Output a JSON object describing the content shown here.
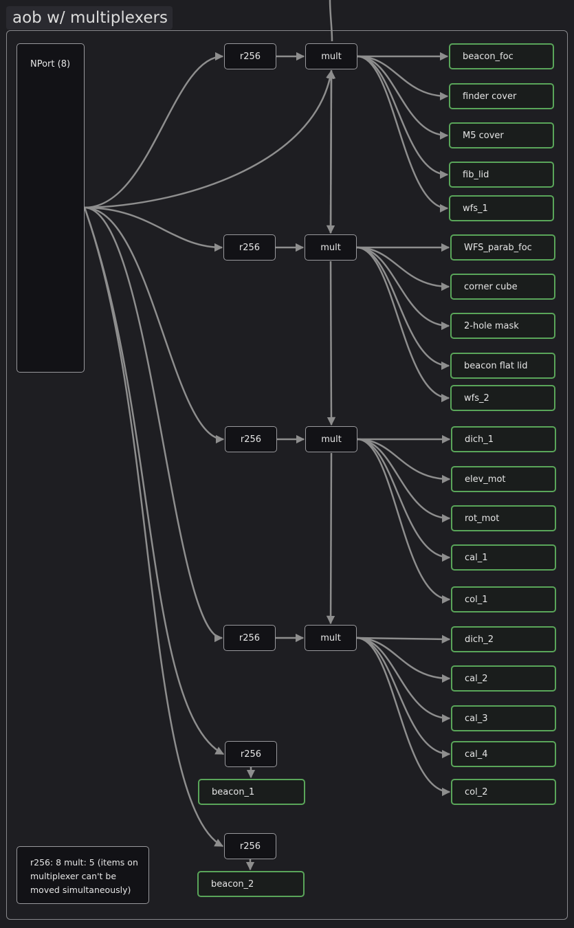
{
  "title": "aob w/ multiplexers",
  "source": "NPort (8)",
  "r256_label": "r256",
  "mult_label": "mult",
  "groups": [
    {
      "targets": [
        "beacon_foc",
        "finder cover",
        "M5 cover",
        "fib_lid",
        "wfs_1"
      ]
    },
    {
      "targets": [
        "WFS_parab_foc",
        "corner cube",
        "2-hole mask",
        "beacon flat lid",
        "wfs_2"
      ]
    },
    {
      "targets": [
        "dich_1",
        "elev_mot",
        "rot_mot",
        "cal_1",
        "col_1"
      ]
    },
    {
      "targets": [
        "dich_2",
        "cal_2",
        "cal_3",
        "cal_4",
        "col_2"
      ]
    }
  ],
  "direct": [
    {
      "target": "beacon_1"
    },
    {
      "target": "beacon_2"
    }
  ],
  "note": "r256: 8 mult: 5 (items on multiplexer can't be moved simultaneously)",
  "colors": {
    "background": "#1e1e22",
    "edge": "#8e8e8e",
    "node_border": "#9a9a9e",
    "target_border": "#5aa65a"
  }
}
